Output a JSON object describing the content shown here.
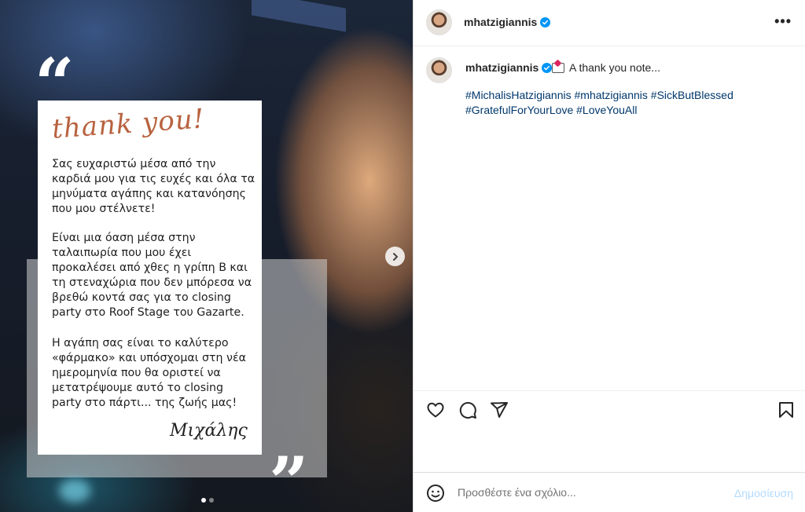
{
  "post": {
    "username": "mhatzigiannis",
    "caption_text": "A thank you note...",
    "hashtags": [
      "#MichalisHatzigiannis",
      "#mhatzigiannis",
      "#SickButBlessed",
      "#GratefulForYourLove",
      "#LoveYouAll"
    ],
    "more_label": "•••",
    "carousel": {
      "current": 1,
      "total": 2
    }
  },
  "card": {
    "open_quote": "“",
    "close_quote": "”",
    "thank_you": "thank you!",
    "p1": "Σας ευχαριστώ μέσα από την καρδιά μου για τις ευχές και όλα τα μηνύματα αγάπης και κατανόησης που μου στέλνετε!",
    "p2": "Είναι μια όαση μέσα στην ταλαιπωρία που μου έχει προκαλέσει από χθες η γρίπη Β και τη στεναχώρια που δεν μπόρεσα να βρεθώ κοντά σας για το closing party στο Roof Stage του Gazarte.",
    "p3": "Η αγάπη σας είναι το καλύτερο «φάρμακο» και υπόσχομαι στη νέα ημερομηνία που θα οριστεί να μετατρέψουμε αυτό το closing party στο πάρτι... της ζωής μας!",
    "signature": "Μιχάλης"
  },
  "comment": {
    "placeholder": "Προσθέστε ένα σχόλιο...",
    "post_label": "Δημοσίευση"
  },
  "colors": {
    "link": "#00376b",
    "verified": "#0095f6",
    "post_disabled": "#b3dbff"
  }
}
